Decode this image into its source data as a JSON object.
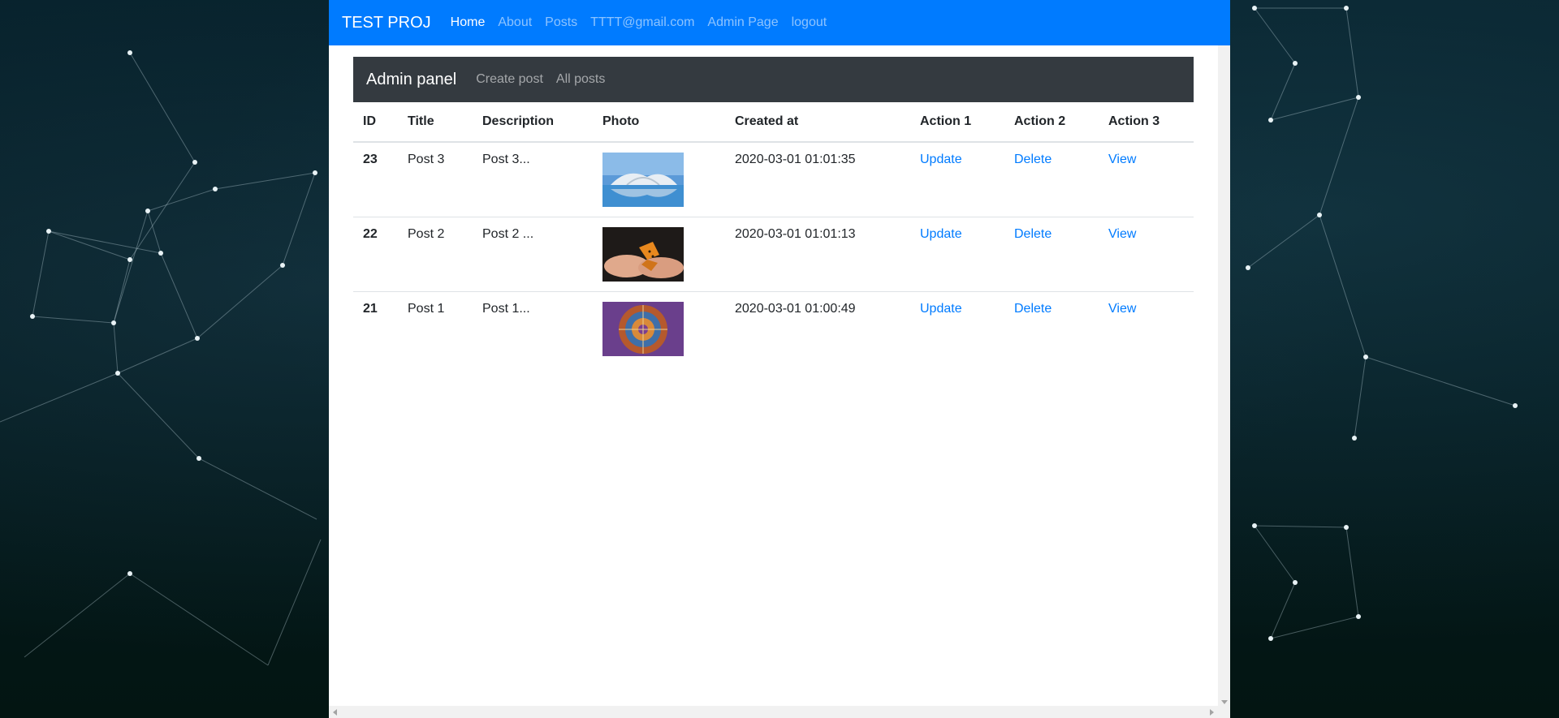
{
  "navbar": {
    "brand": "TEST PROJ",
    "links": [
      "Home",
      "About",
      "Posts",
      "TTTT@gmail.com",
      "Admin Page",
      "logout"
    ],
    "active": "Home"
  },
  "admin_panel": {
    "title": "Admin panel",
    "links": [
      "Create post",
      "All posts"
    ]
  },
  "table": {
    "headers": [
      "ID",
      "Title",
      "Description",
      "Photo",
      "Created at",
      "Action 1",
      "Action 2",
      "Action 3"
    ],
    "rows": [
      {
        "id": "23",
        "title": "Post 3",
        "description": "Post 3...",
        "photo": "architecture-waterfront-image",
        "created_at": "2020-03-01 01:01:35",
        "action1": "Update",
        "action2": "Delete",
        "action3": "View"
      },
      {
        "id": "22",
        "title": "Post 2",
        "description": "Post 2 ...",
        "photo": "butterfly-in-hands-image",
        "created_at": "2020-03-01 01:01:13",
        "action1": "Update",
        "action2": "Delete",
        "action3": "View"
      },
      {
        "id": "21",
        "title": "Post 1",
        "description": "Post 1...",
        "photo": "astronomical-clock-image",
        "created_at": "2020-03-01 01:00:49",
        "action1": "Update",
        "action2": "Delete",
        "action3": "View"
      }
    ]
  },
  "colors": {
    "navbar_bg": "#007bff",
    "admin_bar_bg": "#343a40",
    "link": "#007bff"
  }
}
